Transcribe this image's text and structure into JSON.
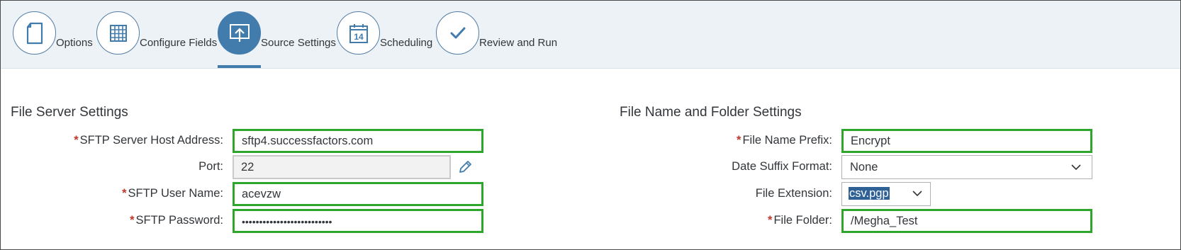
{
  "wizard": {
    "steps": [
      {
        "label": "Options",
        "icon": "document-icon",
        "active": false
      },
      {
        "label": "Configure Fields",
        "icon": "grid-icon",
        "active": false
      },
      {
        "label": "Source Settings",
        "icon": "upload-icon",
        "active": true
      },
      {
        "label": "Scheduling",
        "icon": "calendar-icon",
        "active": false
      },
      {
        "label": "Review and Run",
        "icon": "checkmark-icon",
        "active": false
      }
    ],
    "calendar_day": "14"
  },
  "file_server": {
    "title": "File Server Settings",
    "host": {
      "label": "SFTP Server Host Address:",
      "required": true,
      "value": "sftp4.successfactors.com"
    },
    "port": {
      "label": "Port:",
      "required": false,
      "value": "22"
    },
    "user": {
      "label": "SFTP User Name:",
      "required": true,
      "value": "acevzw"
    },
    "password": {
      "label": "SFTP Password:",
      "required": true,
      "value": "••••••••••••••••••••••••••"
    }
  },
  "file_name": {
    "title": "File Name and Folder Settings",
    "prefix": {
      "label": "File Name Prefix:",
      "required": true,
      "value": "Encrypt"
    },
    "date_suffix": {
      "label": "Date Suffix Format:",
      "required": false,
      "value": "None"
    },
    "extension": {
      "label": "File Extension:",
      "required": false,
      "value": "csv.pgp"
    },
    "folder": {
      "label": "File Folder:",
      "required": true,
      "value": "/Megha_Test"
    }
  },
  "colors": {
    "accent": "#427cac",
    "valid_border": "#2ea52b",
    "required_marker": "#c0392b",
    "header_bg": "#edf2f7"
  },
  "required_marker": "*"
}
